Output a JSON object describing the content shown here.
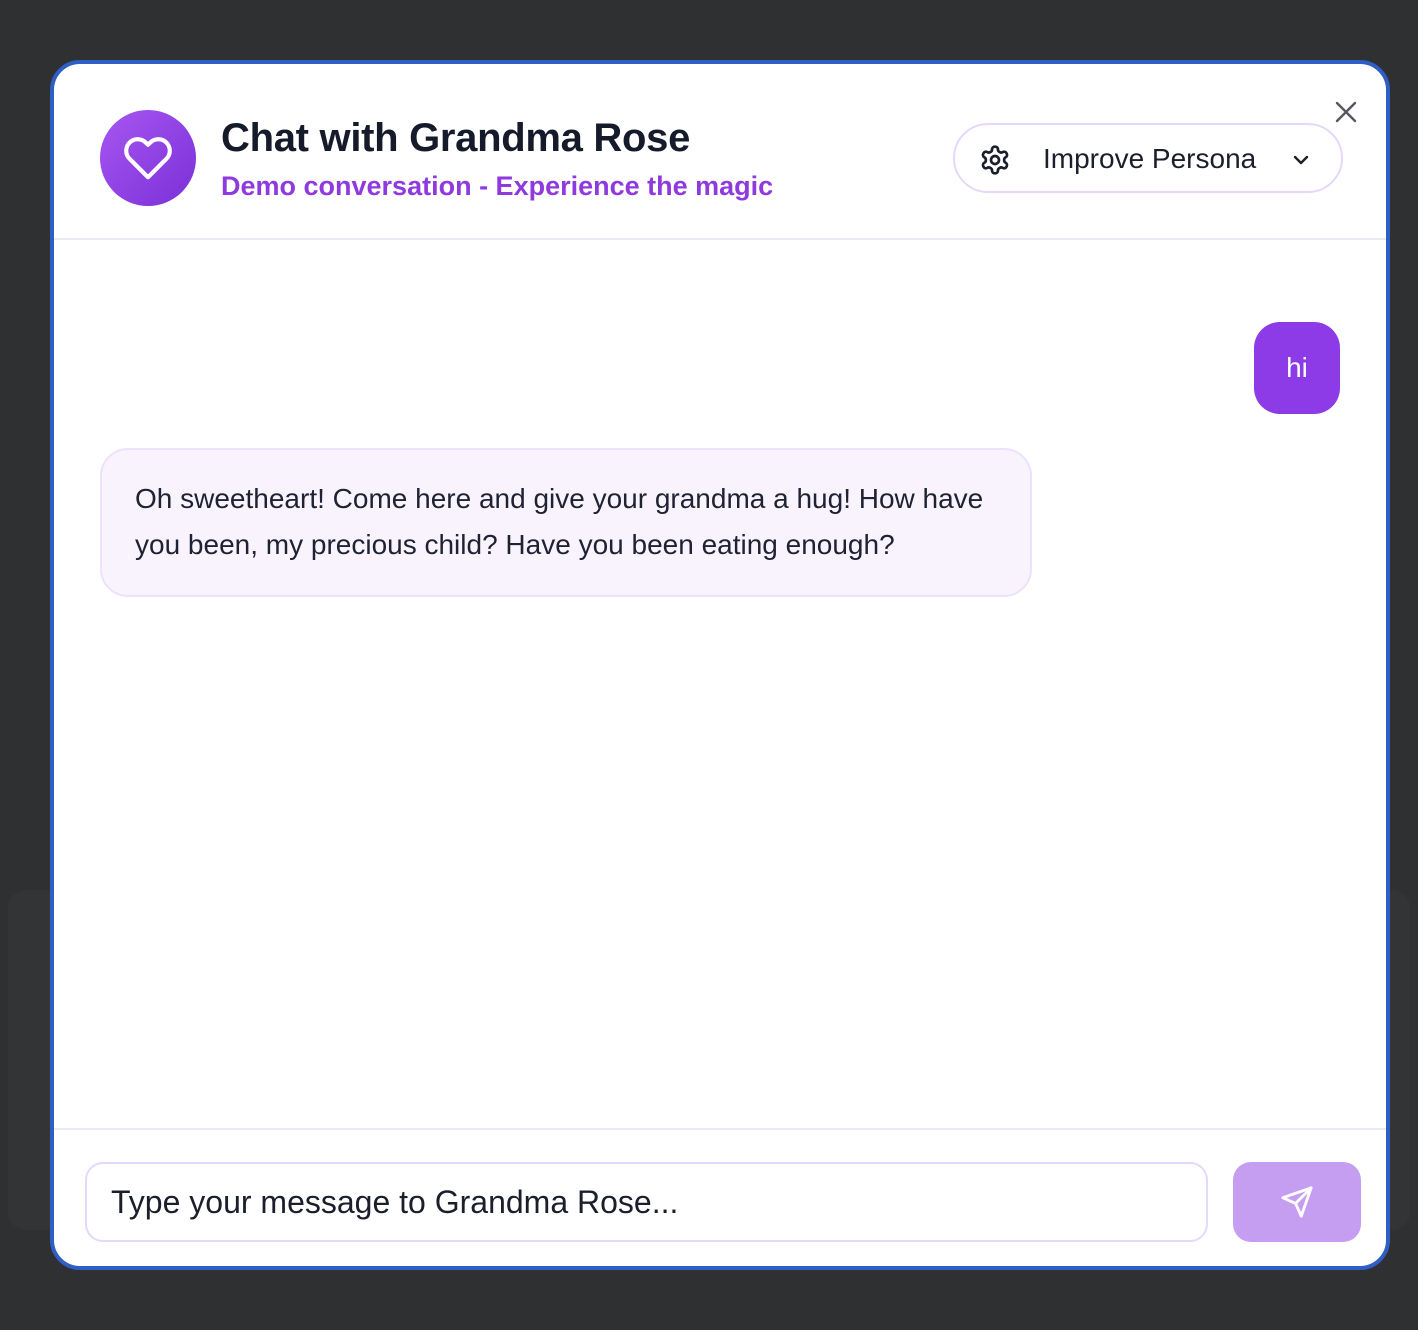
{
  "header": {
    "title": "Chat with Grandma Rose",
    "subtitle": "Demo conversation - Experience the magic",
    "avatar_icon": "heart-icon",
    "close_icon": "close-icon",
    "persona_button": {
      "label": "Improve Persona",
      "icon": "gear-icon",
      "dropdown_icon": "chevron-down-icon"
    }
  },
  "messages": [
    {
      "role": "user",
      "text": "hi"
    },
    {
      "role": "assistant",
      "text": "Oh sweetheart! Come here and give your grandma a hug! How have you been, my precious child? Have you been eating enough?"
    }
  ],
  "composer": {
    "placeholder": "Type your message to Grandma Rose...",
    "value": "",
    "send_icon": "send-icon"
  },
  "colors": {
    "accent": "#8d3be6",
    "subtitle": "#8f3ade",
    "send_button": "#c69ef1",
    "modal_border": "#2f5fc4",
    "assistant_bubble": "#f8f3fd",
    "backdrop": "#2f3031"
  }
}
